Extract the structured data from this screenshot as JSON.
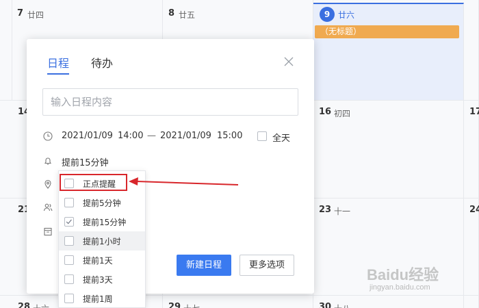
{
  "calendar": {
    "days": [
      {
        "num": "7",
        "lunar": "廿四"
      },
      {
        "num": "8",
        "lunar": "廿五"
      },
      {
        "num": "9",
        "lunar": "廿六"
      },
      {
        "num": "14",
        "lunar": ""
      },
      {
        "num": "16",
        "lunar": "初四"
      },
      {
        "num": "17",
        "lunar": ""
      },
      {
        "num": "21",
        "lunar": ""
      },
      {
        "num": "23",
        "lunar": "十一"
      },
      {
        "num": "24",
        "lunar": ""
      },
      {
        "num": "28",
        "lunar": "十六"
      },
      {
        "num": "29",
        "lunar": "十七"
      },
      {
        "num": "30",
        "lunar": "十八"
      }
    ],
    "event_label": "（无标题）",
    "today_color": "#3a6fe0",
    "event_color": "#f0aa50"
  },
  "popup": {
    "tabs": [
      "日程",
      "待办"
    ],
    "input_placeholder": "输入日程内容",
    "start_date": "2021/01/09",
    "start_time": "14:00",
    "dash": "—",
    "end_date": "2021/01/09",
    "end_time": "15:00",
    "allday_label": "全天",
    "reminder_value": "提前15分钟",
    "create_button": "新建日程",
    "more_button": "更多选项"
  },
  "reminder_options": [
    {
      "label": "正点提醒",
      "checked": false
    },
    {
      "label": "提前5分钟",
      "checked": false
    },
    {
      "label": "提前15分钟",
      "checked": true
    },
    {
      "label": "提前1小时",
      "checked": false
    },
    {
      "label": "提前1天",
      "checked": false
    },
    {
      "label": "提前3天",
      "checked": false
    },
    {
      "label": "提前1周",
      "checked": false
    }
  ],
  "watermark": {
    "main": "Baidu经验",
    "sub": "jingyan.baidu.com"
  }
}
